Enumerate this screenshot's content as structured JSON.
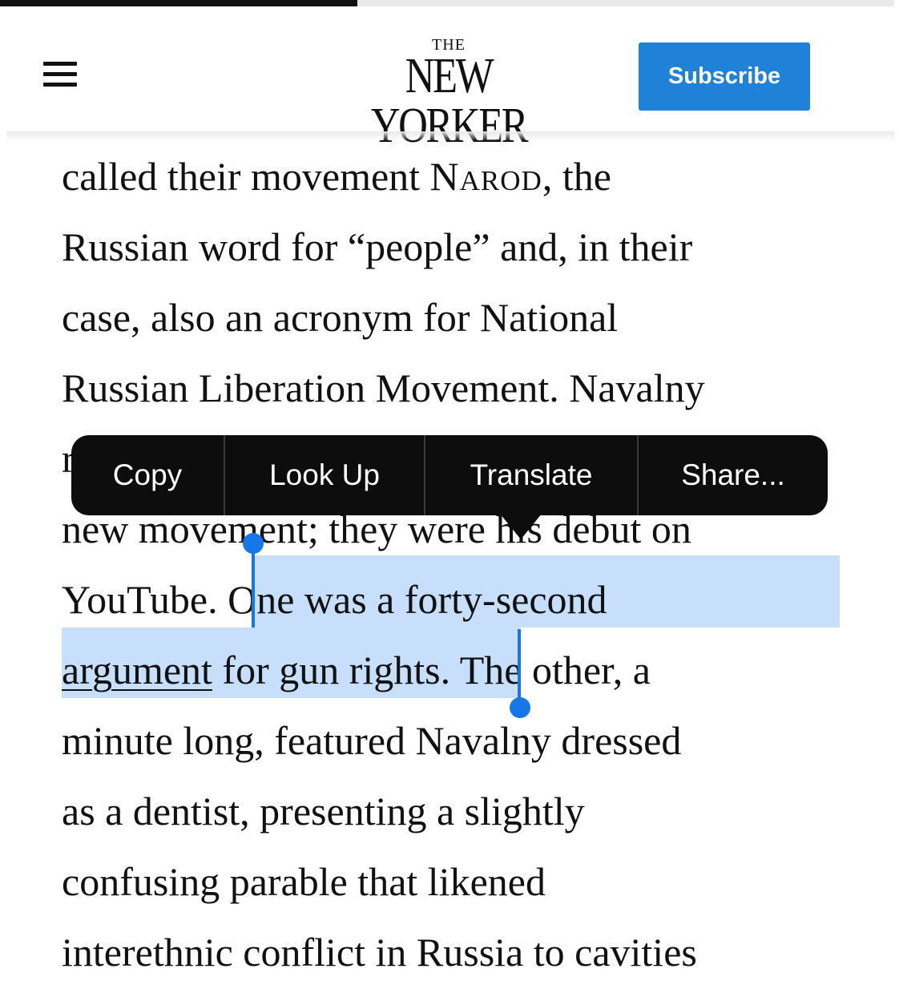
{
  "reading_progress": 0.4,
  "header": {
    "logo_top": "THE",
    "logo_main": "NEW YORKER",
    "subscribe_label": "Subscribe"
  },
  "context_menu": {
    "items": [
      "Copy",
      "Look Up",
      "Translate",
      "Share..."
    ]
  },
  "article": {
    "line1": {
      "a": "called their movement ",
      "sc": "Narod",
      "b": ", the"
    },
    "line2": "Russian word for “people” and, in their",
    "line3": "case, also an acronym for National",
    "line4": "Russian Liberation Movement. Navalny",
    "line5": "r",
    "line6": "new movement; they were his debut on",
    "line7": {
      "before": "YouTube. ",
      "selected": "One was a forty-second"
    },
    "line8": {
      "link": "argument",
      "selected_rest": " for gun rights",
      "after": ". The other, a"
    },
    "line9": "minute long, featured Navalny dressed",
    "line10": "as a dentist, presenting a slightly",
    "line11": "confusing parable that likened",
    "line12": "interethnic conflict in Russia to cavities"
  },
  "colors": {
    "subscribe_bg": "#1f82d8",
    "selection": "#c7dffb",
    "selection_handle": "#1677e8",
    "menu_bg": "#0d0d0d"
  }
}
